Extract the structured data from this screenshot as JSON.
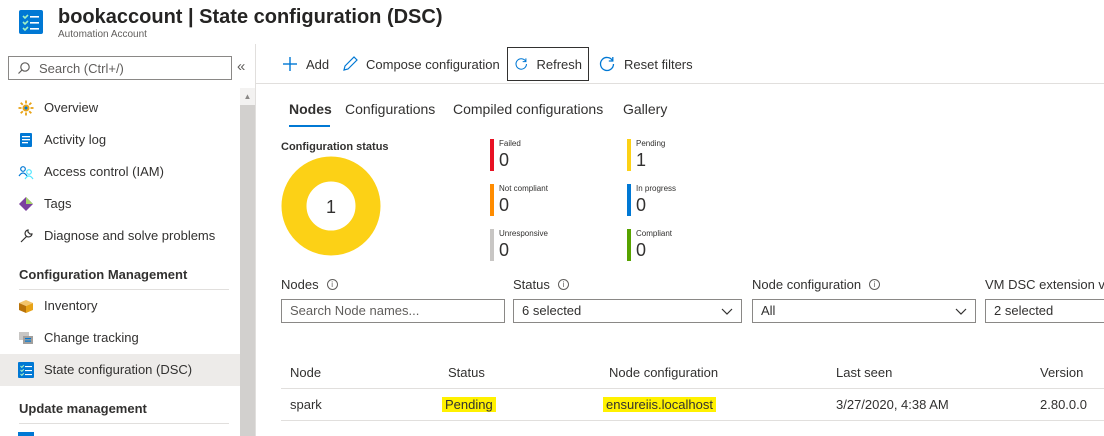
{
  "header": {
    "title": "bookaccount | State configuration (DSC)",
    "subtitle": "Automation Account"
  },
  "sidebar": {
    "search_placeholder": "Search (Ctrl+/)",
    "collapse_glyph": "«",
    "items": [
      {
        "label": "Overview",
        "icon": "overview-icon"
      },
      {
        "label": "Activity log",
        "icon": "activity-log-icon"
      },
      {
        "label": "Access control (IAM)",
        "icon": "access-control-icon"
      },
      {
        "label": "Tags",
        "icon": "tags-icon"
      },
      {
        "label": "Diagnose and solve problems",
        "icon": "wrench-icon"
      }
    ],
    "section1": "Configuration Management",
    "section1_items": [
      {
        "label": "Inventory",
        "icon": "inventory-icon"
      },
      {
        "label": "Change tracking",
        "icon": "change-tracking-icon"
      },
      {
        "label": "State configuration (DSC)",
        "icon": "dsc-icon",
        "active": true
      }
    ],
    "section2": "Update management"
  },
  "toolbar": {
    "add": "Add",
    "compose": "Compose configuration",
    "refresh": "Refresh",
    "reset": "Reset filters"
  },
  "tabs": [
    "Nodes",
    "Configurations",
    "Compiled configurations",
    "Gallery"
  ],
  "status": {
    "title": "Configuration status",
    "donut_value": "1",
    "tiles": [
      {
        "label": "Failed",
        "value": "0",
        "color": "#e81123"
      },
      {
        "label": "Pending",
        "value": "1",
        "color": "#fcd116"
      },
      {
        "label": "Not compliant",
        "value": "0",
        "color": "#ff8c00"
      },
      {
        "label": "In progress",
        "value": "0",
        "color": "#0078d4"
      },
      {
        "label": "Unresponsive",
        "value": "0",
        "color": "#c8c6c4"
      },
      {
        "label": "Compliant",
        "value": "0",
        "color": "#57a300"
      }
    ]
  },
  "filters": {
    "nodes_label": "Nodes",
    "nodes_placeholder": "Search Node names...",
    "status_label": "Status",
    "status_value": "6 selected",
    "nodeconf_label": "Node configuration",
    "nodeconf_value": "All",
    "vmdsc_label": "VM DSC extension v",
    "vmdsc_value": "2 selected"
  },
  "table": {
    "headers": [
      "Node",
      "Status",
      "Node configuration",
      "Last seen",
      "Version"
    ],
    "rows": [
      {
        "node": "spark",
        "status": "Pending",
        "config": "ensureiis.localhost",
        "last_seen": "3/27/2020, 4:38 AM",
        "version": "2.80.0.0"
      }
    ]
  },
  "colors": {
    "accent": "#0078d4",
    "donut": "#fcd116",
    "highlight": "#fff100"
  }
}
